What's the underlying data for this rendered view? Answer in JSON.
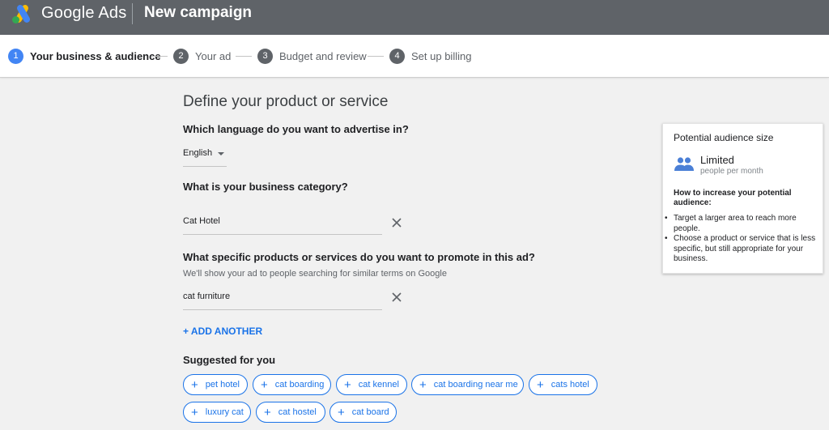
{
  "header": {
    "brand": "Google Ads",
    "title": "New campaign"
  },
  "steps": [
    {
      "number": "1",
      "label": "Your business & audience",
      "active": true
    },
    {
      "number": "2",
      "label": "Your ad",
      "active": false
    },
    {
      "number": "3",
      "label": "Budget and review",
      "active": false
    },
    {
      "number": "4",
      "label": "Set up billing",
      "active": false
    }
  ],
  "main": {
    "section_title": "Define your product or service",
    "language": {
      "question": "Which language do you want to advertise in?",
      "selected": "English"
    },
    "category": {
      "question": "What is your business category?",
      "value": "Cat Hotel"
    },
    "products": {
      "question": "What specific products or services do you want to promote in this ad?",
      "hint": "We'll show your ad to people searching for similar terms on Google",
      "value": "cat furniture"
    },
    "add_another": "+ ADD ANOTHER",
    "suggested_heading": "Suggested for you",
    "suggestions": [
      "pet hotel",
      "cat boarding",
      "cat kennel",
      "cat boarding near me",
      "cats hotel",
      "luxury cat",
      "cat hostel",
      "cat board"
    ]
  },
  "audience": {
    "title": "Potential audience size",
    "level": "Limited",
    "unit": "people per month",
    "tips_heading": "How to increase your potential audience:",
    "tips": [
      "Target a larger area to reach more people.",
      "Choose a product or service that is less specific, but still appropriate for your business."
    ]
  },
  "colors": {
    "topbar": "#5f6368",
    "accent": "#1a73e8",
    "active_step": "#4285f4",
    "people_icon": "#4a7fd6"
  }
}
